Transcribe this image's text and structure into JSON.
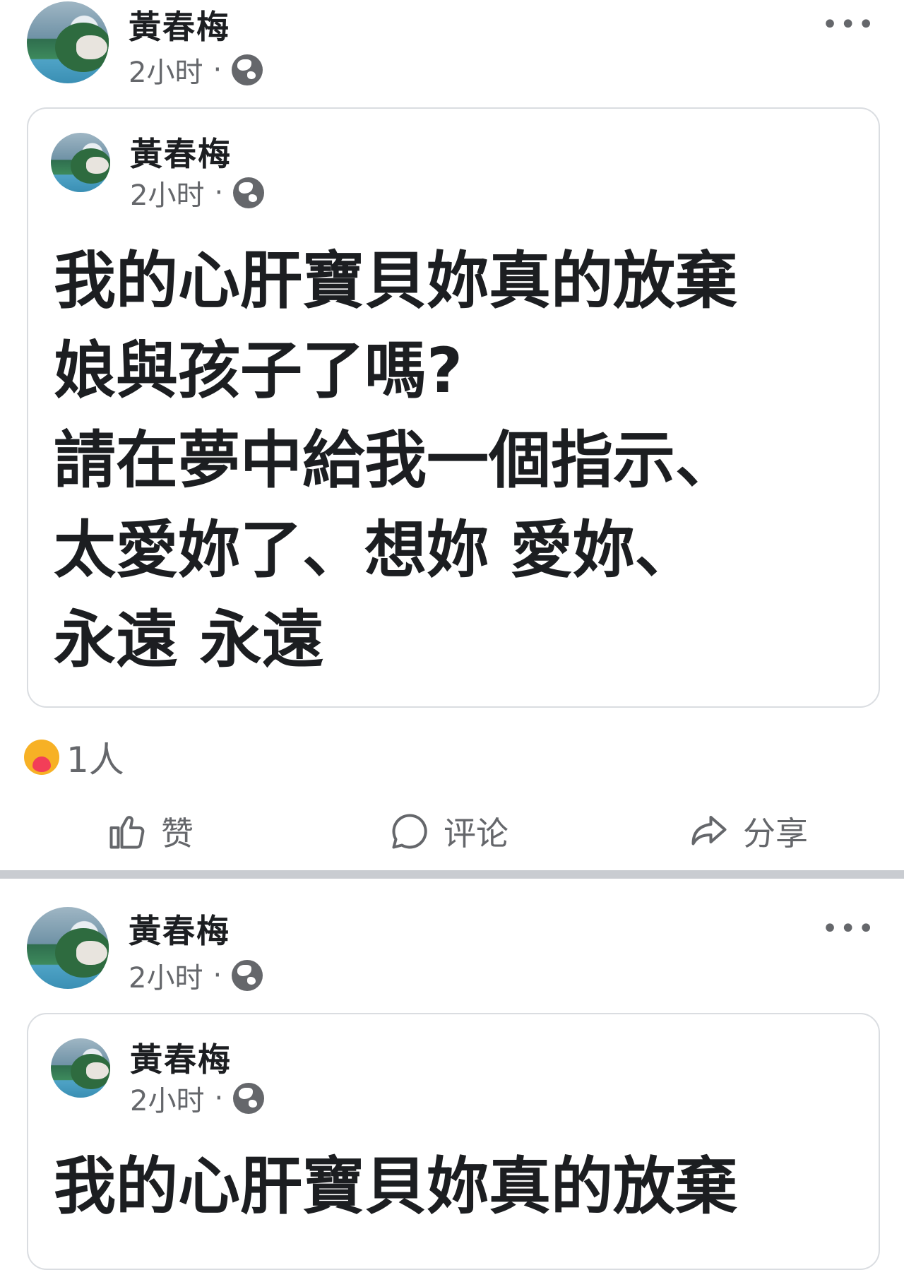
{
  "post1": {
    "author": "黃春梅",
    "time": "2小时",
    "dot": "·",
    "more": "•••",
    "shared": {
      "author": "黃春梅",
      "time": "2小时",
      "dot": "·",
      "text": "我的心肝寶貝妳真的放棄\n娘與孩子了嗎?\n請在夢中給我一個指示、\n太愛妳了、想妳 愛妳、\n永遠 永遠"
    },
    "reactions": {
      "icon": "care-icon",
      "count": "1人"
    },
    "actions": {
      "like": "赞",
      "comment": "评论",
      "share": "分享"
    }
  },
  "post2": {
    "author": "黃春梅",
    "time": "2小时",
    "dot": "·",
    "more": "•••",
    "shared": {
      "author": "黃春梅",
      "time": "2小时",
      "dot": "·",
      "text": "我的心肝寶貝妳真的放棄"
    }
  },
  "colors": {
    "text": "#1c1e21",
    "secondary": "#65676b",
    "border": "#dadde1",
    "separator": "#c9ccd1"
  }
}
